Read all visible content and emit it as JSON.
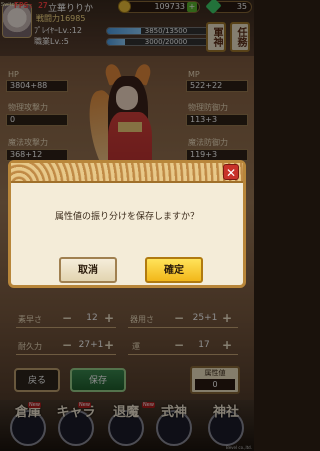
{
  "debug": {
    "switch_tag": "Switch",
    "fps": "FPS: 27"
  },
  "player": {
    "name": "立華りりか",
    "combat_power": "戦闘力16985",
    "level_label": "ﾌﾟﾚｲﾔｰLv.:12",
    "exp": "3850/13500",
    "exp_fraction": 0.285,
    "job_level_label": "職業Lv.:5",
    "job_exp": "3000/20000",
    "job_exp_fraction": 0.15
  },
  "currency": {
    "coins": "109733",
    "gems": "35"
  },
  "menu_tabs": [
    "軍神",
    "任務"
  ],
  "stats": {
    "hp_label": "HP",
    "hp": "3804+88",
    "mp_label": "MP",
    "mp": "522+22",
    "phys_atk_label": "物理攻撃力",
    "phys_atk": "0",
    "phys_def_label": "物理防御力",
    "phys_def": "113+3",
    "mag_atk_label": "魔法攻撃力",
    "mag_atk": "368+12",
    "mag_def_label": "魔法防御力",
    "mag_def": "119+3"
  },
  "dialog": {
    "message": "属性値の振り分けを保存しますか？",
    "cancel": "取消",
    "confirm": "確定",
    "close": "✕"
  },
  "allocation": {
    "speed_label": "素早さ",
    "speed": "12",
    "dex_label": "器用さ",
    "dex": "25+1",
    "stamina_label": "耐久力",
    "stamina": "27+1",
    "luck_label": "運",
    "luck": "17"
  },
  "buttons": {
    "back": "戻る",
    "save": "保存",
    "attr_label": "属性値",
    "attr_value": "0"
  },
  "nav": [
    {
      "label": "倉庫"
    },
    {
      "label": "キャラ"
    },
    {
      "label": "退魔"
    },
    {
      "label": "式神"
    },
    {
      "label": "神社"
    }
  ],
  "nav_new": "New",
  "copyright": "Bevel co.,ltd."
}
